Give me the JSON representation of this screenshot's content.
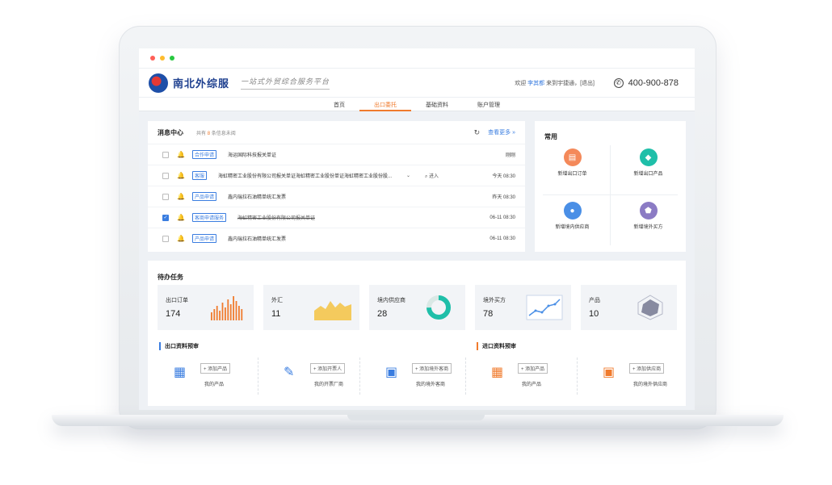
{
  "header": {
    "brand": "南北外综服",
    "slogan": "一站式外贸综合服务平台",
    "welcome_prefix": "欢迎",
    "user": "李其都",
    "welcome_suffix": "来到宇捷通，[退出]",
    "phone_icon": "phone-icon",
    "phone": "400-900-878"
  },
  "nav": {
    "items": [
      "首页",
      "出口委托",
      "基础资料",
      "账户管理"
    ],
    "active": "出口委托",
    "accent": "#f07b2d"
  },
  "messages": {
    "title": "消息中心",
    "count_prefix": "共有",
    "count": "8",
    "count_suffix": "条信息未阅",
    "more": "查看更多",
    "rows": [
      {
        "tag": "合作申请",
        "text": "海运国际科技报关单证",
        "extra": "",
        "time": "刚刚",
        "checked": false,
        "done": false
      },
      {
        "tag": "客服",
        "text": "海虹精密工业股份有限公司报关单证海虹精密工业股份单证海虹精密工业股份股...",
        "extra": "进入",
        "time": "今天 08:30",
        "checked": false,
        "done": false
      },
      {
        "tag": "产品申请",
        "text": "鑫内瑞拉石油精单统汇发票",
        "extra": "",
        "time": "昨天 08:30",
        "checked": false,
        "done": false
      },
      {
        "tag": "客商申请服务",
        "text": "海虹精密工业股份有限公司报关单证",
        "extra": "",
        "time": "06-11 08:30",
        "checked": true,
        "done": true
      },
      {
        "tag": "产品申请",
        "text": "鑫内瑞拉石油精单统汇发票",
        "extra": "",
        "time": "06-11 08:30",
        "checked": false,
        "done": false
      }
    ]
  },
  "common": {
    "title": "常用",
    "items": [
      {
        "label": "新增出口订单",
        "icon": "order-icon",
        "color": "#f4895a"
      },
      {
        "label": "新增出口产品",
        "icon": "box-icon",
        "color": "#1fbfa9"
      },
      {
        "label": "新增境内供应商",
        "icon": "user-icon",
        "color": "#4a8fe6"
      },
      {
        "label": "新增境外买方",
        "icon": "shield-icon",
        "color": "#8b7bc4"
      }
    ]
  },
  "todo": {
    "title": "待办任务",
    "stats": [
      {
        "label": "出口订单",
        "value": "174",
        "chart": "bars",
        "color": "#f07b2d"
      },
      {
        "label": "外汇",
        "value": "11",
        "chart": "area",
        "color": "#f5c242"
      },
      {
        "label": "境内供应商",
        "value": "28",
        "chart": "donut",
        "color": "#1fbfa9"
      },
      {
        "label": "境外买方",
        "value": "78",
        "chart": "line",
        "color": "#4a8fe6"
      },
      {
        "label": "产品",
        "value": "10",
        "chart": "radar",
        "color": "#6b6f8a"
      }
    ],
    "export_title": "出口资料预审",
    "import_title": "进口资料预审",
    "export_items": [
      {
        "button": "+ 添加产品",
        "label": "我的产品",
        "icon": "product-icon",
        "color": "#3a7de0"
      },
      {
        "button": "+ 添加开票人",
        "label": "我的开票厂商",
        "icon": "invoice-icon",
        "color": "#3a7de0"
      },
      {
        "button": "+ 添加境外客商",
        "label": "我的境外客商",
        "icon": "briefcase-icon",
        "color": "#3a7de0"
      }
    ],
    "import_items": [
      {
        "button": "+ 添加产品",
        "label": "我的产品",
        "icon": "product-icon",
        "color": "#f07b2d"
      },
      {
        "button": "+ 添加供应商",
        "label": "我的境外供应商",
        "icon": "briefcase-icon",
        "color": "#f07b2d"
      }
    ]
  }
}
